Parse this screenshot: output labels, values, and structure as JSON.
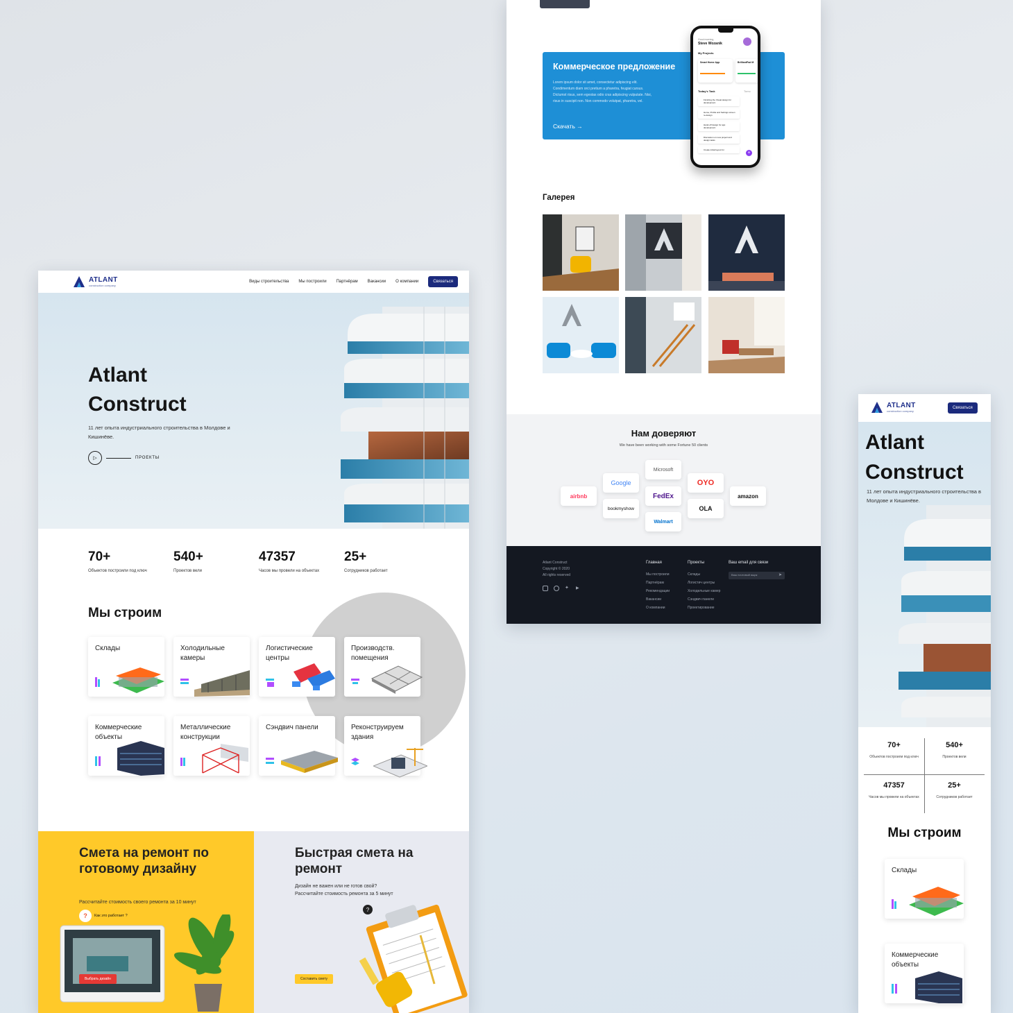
{
  "brand": {
    "name": "ATLANT",
    "tagline": "construction company"
  },
  "nav": {
    "items": [
      "Виды строительства",
      "Мы построили",
      "Партнёрам",
      "Вакансии",
      "О компании"
    ],
    "cta": "Связаться"
  },
  "hero": {
    "title_line1": "Atlant",
    "title_line2": "Construct",
    "subtitle": "11 лет опыта индустриального строительства в Молдове и Кишинёве.",
    "play_label": "ПРОЕКТЫ"
  },
  "stats": [
    {
      "value": "70+",
      "label": "Объектов построили под ключ"
    },
    {
      "value": "540+",
      "label": "Проектов вели"
    },
    {
      "value": "47357",
      "label": "Часов мы провели на объектах"
    },
    {
      "value": "25+",
      "label": "Сотрудников работает"
    }
  ],
  "we_build": {
    "title": "Мы строим",
    "cards": [
      "Склады",
      "Холодильные камеры",
      "Логистические центры",
      "Производств. помещения",
      "Коммерческие объекты",
      "Металлические конструкции",
      "Сэндвич панели",
      "Реконструируем здания"
    ]
  },
  "estimate_ready": {
    "title": "Смета на ремонт по готовому дизайну",
    "subtitle": "Рассчитайте стоимость своего ремонта за 10 минут",
    "how": "Как это работает ?",
    "button": "Выбрать дизайн"
  },
  "estimate_fast": {
    "title": "Быстрая смета на ремонт",
    "subtitle": "Дизайн не важен или не готов свой? Рассчитайте стоимость ремонта за 5 минут",
    "button": "Составить смету"
  },
  "promo": {
    "title": "Коммерческое предложение",
    "text": "Lorem ipsum dolor sit amet, consectetur adipiscing elit. Condimentum diam orci pretium a pharetra, feugiat cursus. Dictumst risus, sem egestas odio cras adipiscing vulputate. Nisi, risus in suscipit non. Non commodo volutpat, pharetra, vel.",
    "link": "Скачать →"
  },
  "phone": {
    "greeting": "Good morning,",
    "user": "Steve Wozanik",
    "projects_label": "My Projects",
    "project1": "Smart Home App",
    "project2": "BrilliantPad M",
    "tasks_label": "Today's Task",
    "tomorrow": "Tomo",
    "tasks": [
      "Finishing the Visual design for development",
      "Home, Profile and Settings screen re-design",
      "Hand-off design for app development",
      "Discussion on new project and design tasks",
      "Create initial layout for"
    ]
  },
  "gallery": {
    "title": "Галерея"
  },
  "trust": {
    "title": "Нам доверяют",
    "subtitle": "We have been working with some Fortune 50 clients",
    "logos": [
      "airbnb",
      "Google",
      "bookmyshow",
      "Microsoft",
      "FedEx",
      "Walmart",
      "OYO",
      "OLA",
      "amazon"
    ]
  },
  "footer": {
    "company": "Atlant Construct",
    "copyright": "Copyright © 2020",
    "rights": "All rights reserved",
    "col1_title": "Главная",
    "col1": [
      "Мы построили",
      "Партнёрам",
      "Рекомендации",
      "Вакансии",
      "О компании"
    ],
    "col2_title": "Проекты",
    "col2": [
      "Склады",
      "Логистич центры",
      "Холодильные камер",
      "Сэндвич панели",
      "Проектирование"
    ],
    "email_title": "Ваш email для связи",
    "email_placeholder": "Ваш почтовый ящик"
  },
  "mobile": {
    "hero_subtitle": "11 лет опыта индустриального строительства в Молдове и Кишинёве.",
    "stats": [
      {
        "value": "70+",
        "label": "Объектов построили под ключ"
      },
      {
        "value": "540+",
        "label": "Проектов вели"
      },
      {
        "value": "47357",
        "label": "Часов мы провели на объектах"
      },
      {
        "value": "25+",
        "label": "Сотрудников работает"
      }
    ],
    "cards": [
      "Склады",
      "Коммерческие объекты"
    ]
  }
}
